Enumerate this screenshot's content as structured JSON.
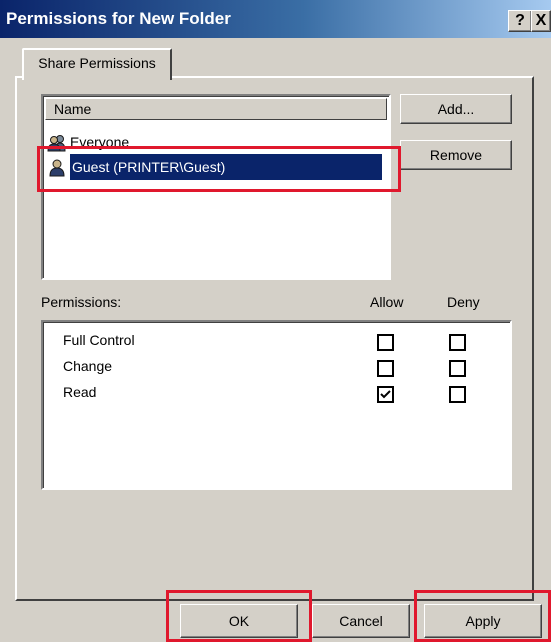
{
  "window": {
    "title": "Permissions for New Folder",
    "help_label": "?",
    "close_label": "X"
  },
  "tabs": [
    {
      "label": "Share Permissions",
      "selected": true
    }
  ],
  "users_list": {
    "column_header": "Name",
    "items": [
      {
        "label": "Everyone",
        "icon": "group-icon",
        "selected": false
      },
      {
        "label": "Guest (PRINTER\\Guest)",
        "icon": "user-icon",
        "selected": true
      }
    ]
  },
  "buttons": {
    "add": "Add...",
    "remove": "Remove",
    "ok": "OK",
    "cancel": "Cancel",
    "apply": "Apply"
  },
  "permissions": {
    "title": "Permissions:",
    "allow_header": "Allow",
    "deny_header": "Deny",
    "rows": [
      {
        "label": "Full Control",
        "allow": false,
        "deny": false
      },
      {
        "label": "Change",
        "allow": false,
        "deny": false
      },
      {
        "label": "Read",
        "allow": true,
        "deny": false
      }
    ]
  },
  "colors": {
    "titlebar_start": "#0a246a",
    "titlebar_end": "#a6caf0",
    "selection": "#0a246a",
    "highlight_annotation": "#e0182d",
    "dialog_face": "#d4d0c8"
  }
}
